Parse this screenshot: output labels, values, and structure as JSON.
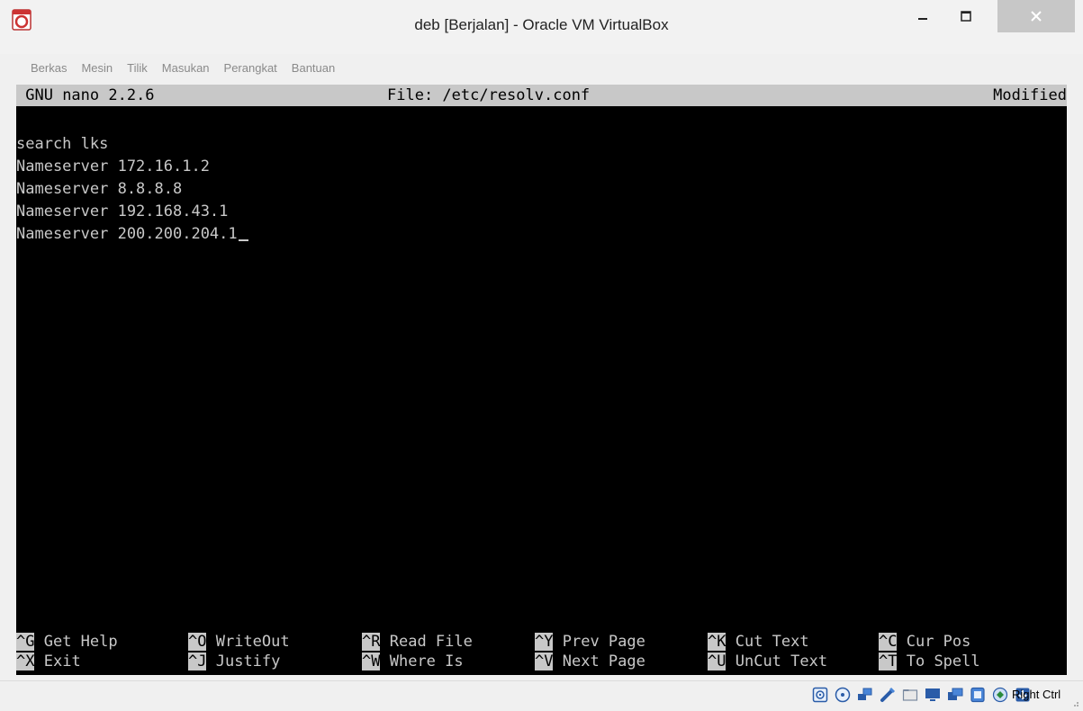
{
  "window": {
    "title": "deb [Berjalan] - Oracle VM VirtualBox"
  },
  "menu": {
    "items": [
      "Berkas",
      "Mesin",
      "Tilik",
      "Masukan",
      "Perangkat",
      "Bantuan"
    ]
  },
  "nano": {
    "version": "GNU nano 2.2.6",
    "file": "File: /etc/resolv.conf",
    "status": "Modified",
    "lines": [
      "search lks",
      "Nameserver 172.16.1.2",
      "Nameserver 8.8.8.8",
      "Nameserver 192.168.43.1",
      "Nameserver 200.200.204.1"
    ],
    "shortcuts_row1": [
      {
        "key": "^G",
        "label": "Get Help"
      },
      {
        "key": "^O",
        "label": "WriteOut"
      },
      {
        "key": "^R",
        "label": "Read File"
      },
      {
        "key": "^Y",
        "label": "Prev Page"
      },
      {
        "key": "^K",
        "label": "Cut Text"
      },
      {
        "key": "^C",
        "label": "Cur Pos"
      }
    ],
    "shortcuts_row2": [
      {
        "key": "^X",
        "label": "Exit"
      },
      {
        "key": "^J",
        "label": "Justify"
      },
      {
        "key": "^W",
        "label": "Where Is"
      },
      {
        "key": "^V",
        "label": "Next Page"
      },
      {
        "key": "^U",
        "label": "UnCut Text"
      },
      {
        "key": "^T",
        "label": "To Spell"
      }
    ]
  },
  "statusbar": {
    "host_key": "Right Ctrl",
    "icons": [
      "hard-disk-icon",
      "optical-disk-icon",
      "network-icon",
      "usb-icon",
      "shared-folders-icon",
      "display-icon",
      "video-capture-icon",
      "guest-additions-icon",
      "mouse-integration-icon",
      "host-key-icon"
    ]
  },
  "colors": {
    "terminal_bg": "#000000",
    "terminal_fg": "#c8c8c8",
    "close_button": "#c7c7c7"
  }
}
